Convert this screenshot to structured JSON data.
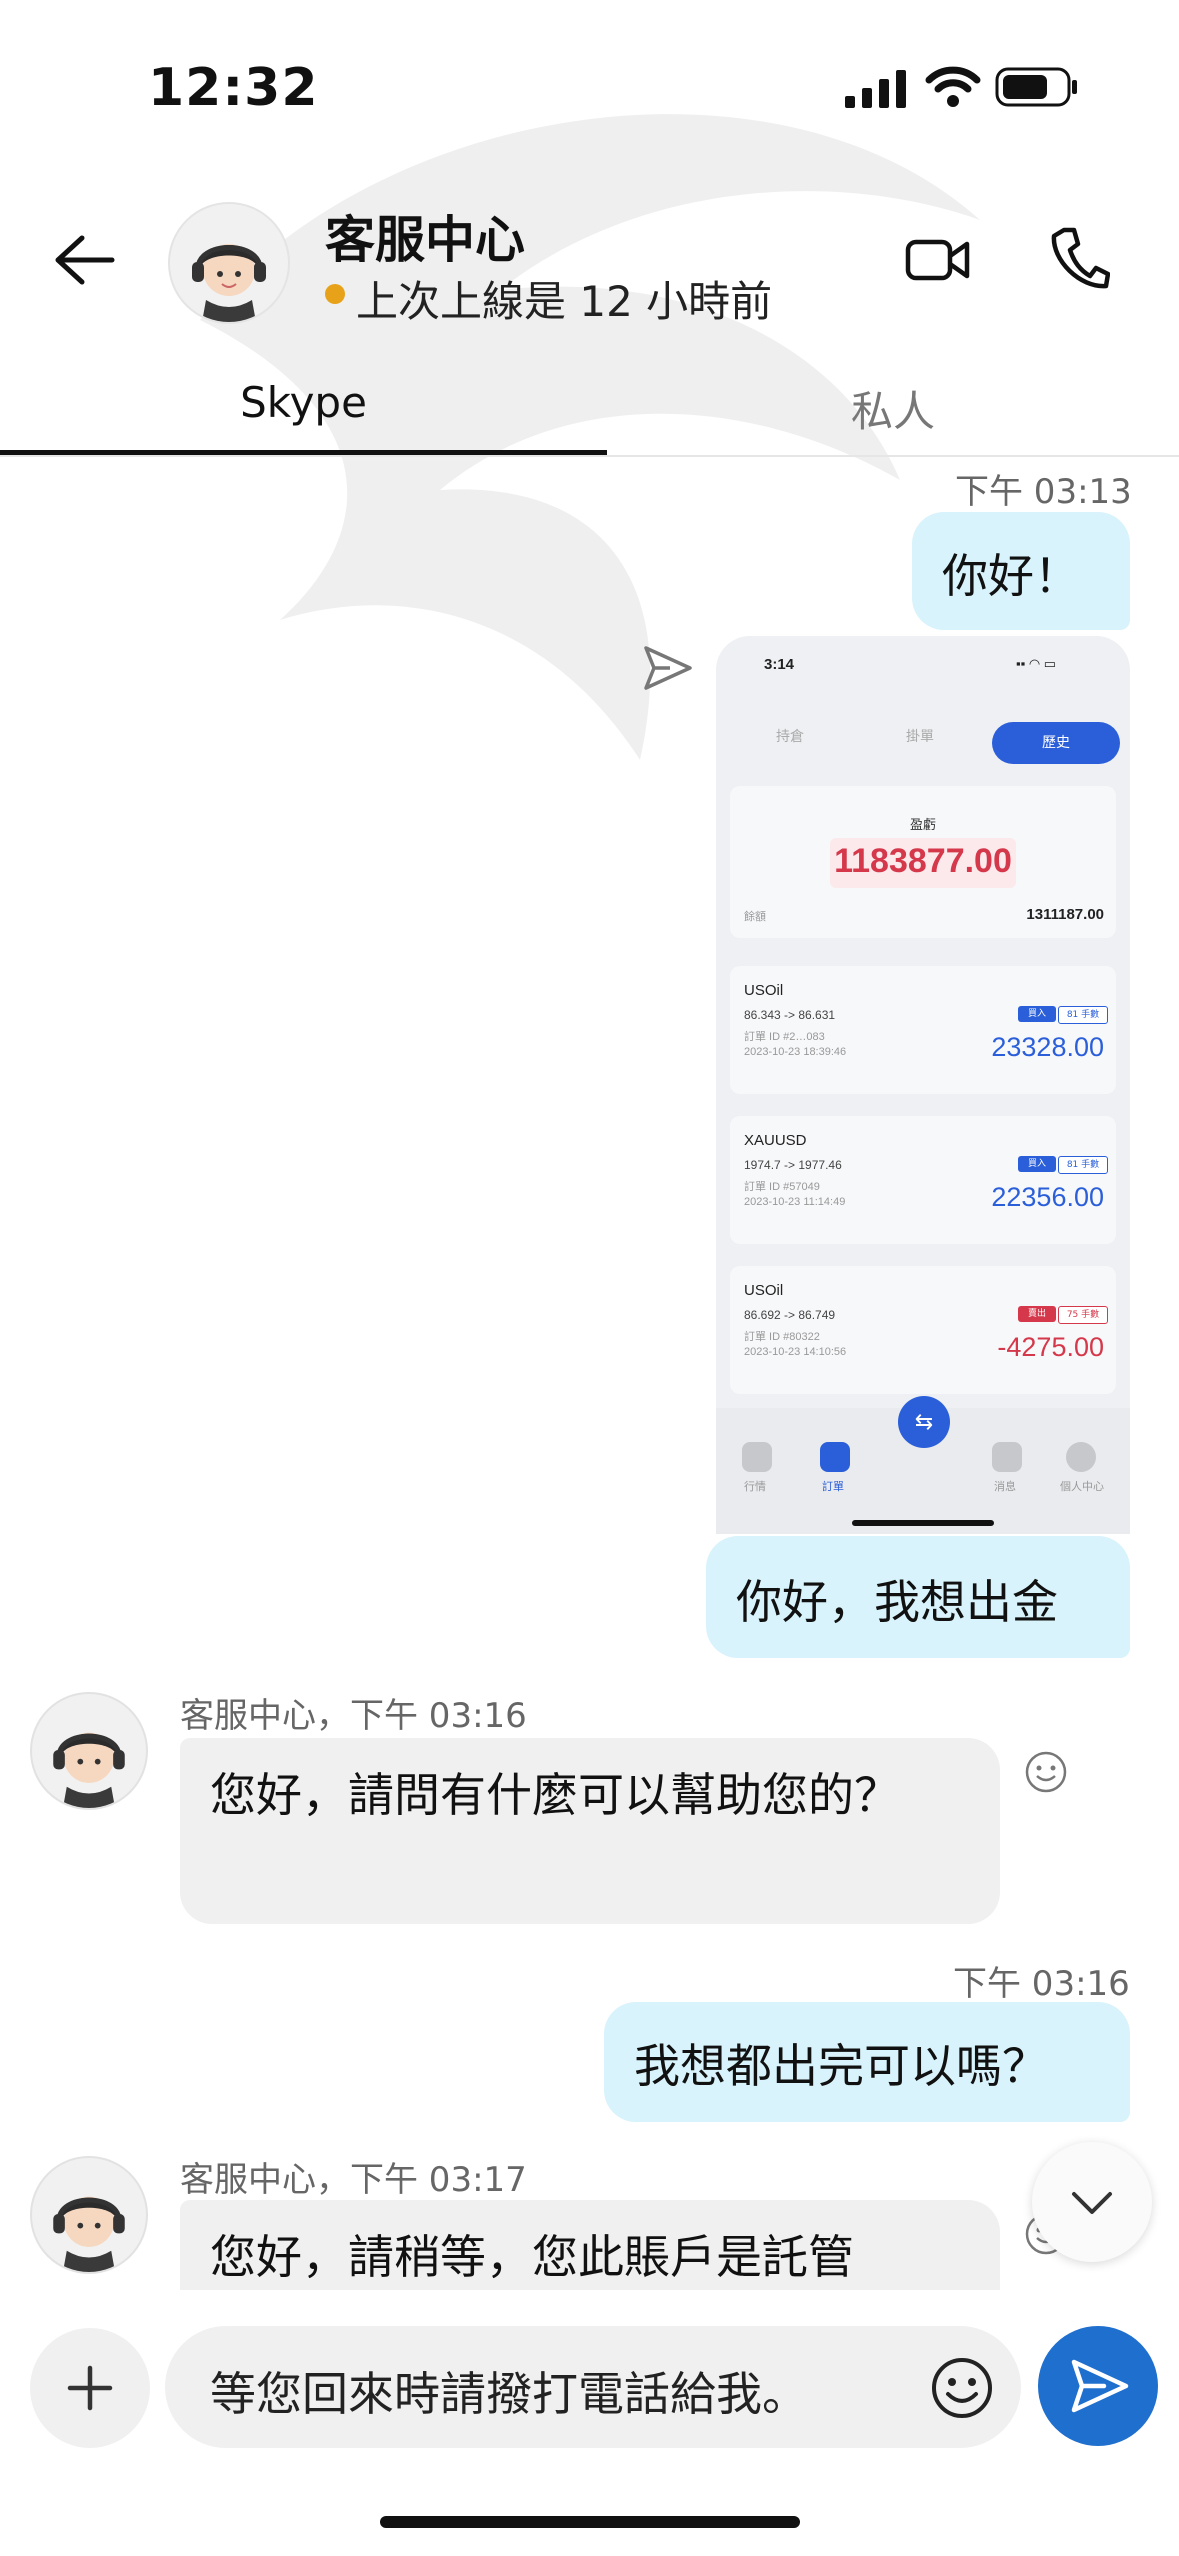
{
  "status_bar": {
    "time": "12:32"
  },
  "header": {
    "name": "客服中心",
    "status": "上次上線是 12 小時前"
  },
  "tabs": [
    {
      "label": "Skype",
      "active": true
    },
    {
      "label": "私人",
      "active": false
    }
  ],
  "messages": {
    "m1_time": "下午 03:13",
    "m1_text": "你好！",
    "shot": {
      "time": "3:14",
      "tabs": [
        "持倉",
        "掛單",
        "歷史"
      ],
      "profit_label": "盈虧",
      "profit_value": "1183877.00",
      "balance_label": "餘額",
      "balance_value": "1311187.00",
      "orders": [
        {
          "symbol": "USOil",
          "prices": "86.343 -> 86.631",
          "order_id": "訂單 ID #2…083",
          "date": "2023-10-23 18:39:46",
          "side": "買入",
          "lots": "81 手數",
          "amount": "23328.00"
        },
        {
          "symbol": "XAUUSD",
          "prices": "1974.7 -> 1977.46",
          "order_id": "訂單 ID #57049",
          "date": "2023-10-23 11:14:49",
          "side": "買入",
          "lots": "81 手數",
          "amount": "22356.00"
        },
        {
          "symbol": "USOil",
          "prices": "86.692 -> 86.749",
          "order_id": "訂單 ID #80322",
          "date": "2023-10-23 14:10:56",
          "side": "賣出",
          "lots": "75 手數",
          "amount": "-4275.00"
        }
      ],
      "nav": [
        "行情",
        "訂單",
        "",
        "消息",
        "個人中心"
      ]
    },
    "m2_text": "你好，我想出金",
    "m3_sender": "客服中心，下午 03:16",
    "m3_text": "您好，請問有什麼可以幫助您的？",
    "m4_time": "下午 03:16",
    "m4_text": "我想都出完可以嗎？",
    "m5_sender": "客服中心，下午 03:17",
    "m5_text": "您好，請稍等，您此賬戶是託管"
  },
  "input": {
    "draft": "等您回來時請撥打電話給我。"
  },
  "colors": {
    "outgoing_bubble": "#d8f3fb",
    "incoming_bubble": "#f0f0f0",
    "send_button": "#1f6fce",
    "status_dot": "#e8a21a"
  }
}
